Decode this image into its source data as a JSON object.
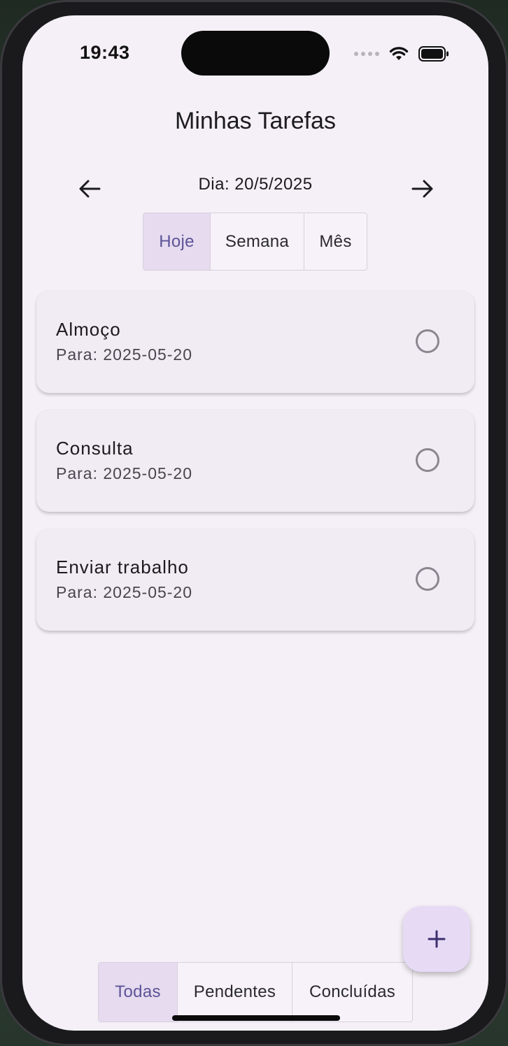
{
  "status_bar": {
    "time": "19:43"
  },
  "app": {
    "title": "Minhas Tarefas",
    "date_label": "Dia: 20/5/2025"
  },
  "period_tabs": [
    {
      "label": "Hoje",
      "selected": true
    },
    {
      "label": "Semana",
      "selected": false
    },
    {
      "label": "Mês",
      "selected": false
    }
  ],
  "tasks": [
    {
      "title": "Almoço",
      "due": "Para: 2025-05-20",
      "done": false
    },
    {
      "title": "Consulta",
      "due": "Para: 2025-05-20",
      "done": false
    },
    {
      "title": "Enviar trabalho",
      "due": "Para: 2025-05-20",
      "done": false
    }
  ],
  "filter_tabs": [
    {
      "label": "Todas",
      "selected": true
    },
    {
      "label": "Pendentes",
      "selected": false
    },
    {
      "label": "Concluídas",
      "selected": false
    }
  ],
  "colors": {
    "accent": "#5c5498",
    "selected_segment": "#e6dbef",
    "fab": "#e6daf5",
    "background": "#f5f0f7"
  },
  "icons": {
    "back": "arrow-left-icon",
    "forward": "arrow-right-icon",
    "add": "plus-icon",
    "check": "radio-unchecked-icon"
  }
}
